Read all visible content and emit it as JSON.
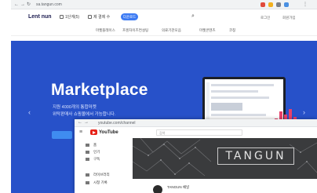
{
  "browser": {
    "url": "sa.tangun.com",
    "extension_colors": [
      "#e04b3c",
      "#f2b01e",
      "#7b7f88",
      "#4a90e2"
    ]
  },
  "site": {
    "logo": "Lent nun",
    "header_links": [
      "1단계(5)",
      "제 결제 수"
    ],
    "header_pill": "다운로드",
    "header_right": [
      "로그인",
      "회원가입"
    ],
    "nav": [
      "마켓플레이스",
      "프렌차이즈컨설팅",
      "의료기관모음",
      "마켓콘텐츠",
      "코칭"
    ]
  },
  "hero": {
    "title": "Marketplace",
    "subtitle_1": "지원 4000개의 통합마켓",
    "subtitle_2": "위탁판매사 쇼핑몰에서 가능합니다.",
    "prev_arrow": "‹",
    "next_arrow": "›",
    "bar_heights": [
      0.55,
      0.85,
      0.7,
      0.95,
      0.6
    ],
    "colors": {
      "hero": "#2751c9",
      "cta": "#3f8cf0",
      "bars": "#e6416a"
    }
  },
  "inner_window": {
    "url": "youtube.com/channel",
    "yt_wordmark": "YouTube",
    "search_placeholder": "검색",
    "side_items": [
      "홈",
      "인기",
      "구독",
      "라이브러리",
      "시청 기록"
    ],
    "banner_text": "TANGUN",
    "channel_name": "TANGUN 채널"
  }
}
